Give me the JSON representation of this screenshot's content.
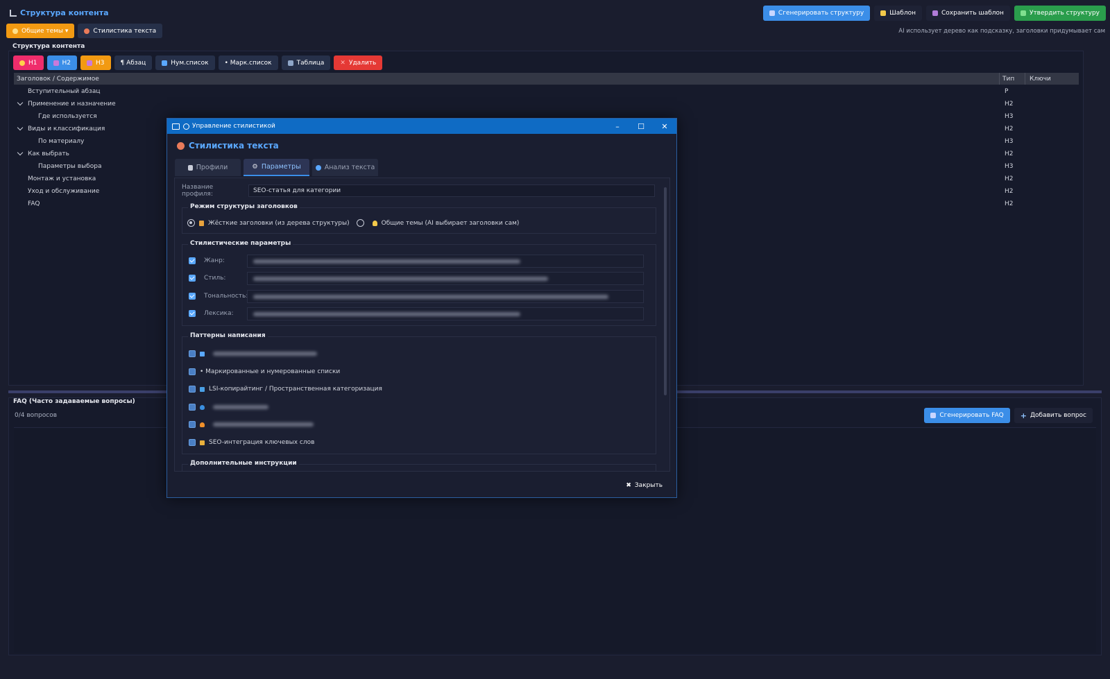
{
  "app": {
    "title": "Структура контента",
    "top_buttons": {
      "generate": "Сгенерировать структуру",
      "template": "Шаблон",
      "save_template": "Сохранить шаблон",
      "approve": "Утвердить структуру"
    },
    "general_topics": "Общие темы ▾",
    "text_style": "Стилистика текста",
    "hint": "AI использует дерево как подсказку, заголовки придумывает сам"
  },
  "structure": {
    "label": "Структура контента",
    "toolbar": {
      "h1": "H1",
      "h2": "H2",
      "h3": "H3",
      "paragraph": "¶ Абзац",
      "numlist": "Нум.список",
      "bullist": "• Марк.список",
      "table": "Таблица",
      "delete": "Удалить"
    },
    "columns": [
      "Заголовок / Содержимое",
      "Тип",
      "Ключи"
    ],
    "rows": [
      {
        "text": "Вступительный абзац",
        "type": "P"
      },
      {
        "text": "Применение и назначение",
        "type": "H2"
      },
      {
        "text": "Где используется",
        "type": "H3"
      },
      {
        "text": "Виды и классификация",
        "type": "H2"
      },
      {
        "text": "По материалу",
        "type": "H3"
      },
      {
        "text": "Как выбрать",
        "type": "H2"
      },
      {
        "text": "Параметры выбора",
        "type": "H3"
      },
      {
        "text": "Монтаж и установка",
        "type": "H2"
      },
      {
        "text": "Уход и обслуживание",
        "type": "H2"
      },
      {
        "text": "FAQ",
        "type": "H2"
      }
    ]
  },
  "faq": {
    "label": "FAQ (Часто задаваемые вопросы)",
    "count": "0/4 вопросов",
    "generate": "Сгенерировать FAQ",
    "add": "Добавить вопрос"
  },
  "dialog": {
    "window_title": "Управление стилистикой",
    "heading": "Стилистика текста",
    "tabs": [
      "Профили",
      "Параметры",
      "Анализ текста"
    ],
    "profile_label": "Название профиля:",
    "profile_value": "SEO-статья для категории",
    "structure_mode": {
      "title": "Режим структуры заголовков",
      "option1": "Жёсткие заголовки (из дерева структуры)",
      "option2": "Общие темы (AI выбирает заголовки сам)",
      "selected": "option1"
    },
    "style_params": {
      "title": "Стилистические параметры",
      "items": [
        {
          "label": "Жанр:",
          "checked": true
        },
        {
          "label": "Стиль:",
          "checked": true
        },
        {
          "label": "Тональность:",
          "checked": true
        },
        {
          "label": "Лексика:",
          "checked": true
        }
      ]
    },
    "patterns": {
      "title": "Паттерны написания",
      "items": [
        {
          "label": "",
          "icon": "table-icon"
        },
        {
          "label": "• Маркированные и нумерованные списки",
          "icon": ""
        },
        {
          "label": "LSI-копирайтинг / Пространственная категоризация",
          "icon": "book-icon"
        },
        {
          "label": "",
          "icon": "shield-icon"
        },
        {
          "label": "",
          "icon": "fire-icon"
        },
        {
          "label": "SEO-интеграция ключевых слов",
          "icon": "key-icon"
        }
      ]
    },
    "extra_title": "Дополнительные инструкции",
    "close": "Закрыть"
  },
  "colors": {
    "accent": "#3b8ee8",
    "green": "#2a9d4c",
    "orange": "#f29a12",
    "red": "#e53935",
    "pink": "#ef2d6c",
    "titlebar": "#0f6bc4"
  }
}
